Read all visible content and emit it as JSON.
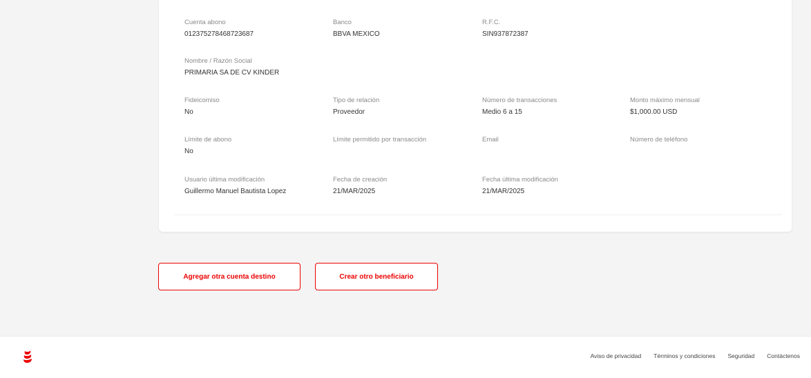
{
  "details": {
    "cuenta_abono": {
      "label": "Cuenta abono",
      "value": "012375278468723687"
    },
    "banco": {
      "label": "Banco",
      "value": "BBVA MEXICO"
    },
    "rfc": {
      "label": "R.F.C.",
      "value": "SIN937872387"
    },
    "nombre": {
      "label": "Nombre / Razón Social",
      "value": "PRIMARIA SA DE CV KINDER"
    },
    "fideicomiso": {
      "label": "Fideicomiso",
      "value": "No"
    },
    "tipo_relacion": {
      "label": "Tipo de relación",
      "value": "Proveedor"
    },
    "num_transacciones": {
      "label": "Número de transacciones",
      "value": "Medio 6 a 15"
    },
    "monto_maximo": {
      "label": "Monto máximo mensual",
      "value": "$1,000.00 USD"
    },
    "limite_abono": {
      "label": "Límite de abono",
      "value": "No"
    },
    "limite_transaccion": {
      "label": "Límite permitido por transacción",
      "value": ""
    },
    "email": {
      "label": "Email",
      "value": ""
    },
    "telefono": {
      "label": "Número de teléfono",
      "value": ""
    },
    "usuario_modificacion": {
      "label": "Usuario última modificación",
      "value": "Guillermo Manuel Bautista Lopez"
    },
    "fecha_creacion": {
      "label": "Fecha de creación",
      "value": "21/MAR/2025"
    },
    "fecha_modificacion": {
      "label": "Fecha última modificación",
      "value": "21/MAR/2025"
    }
  },
  "actions": {
    "add_account": "Agregar otra cuenta destino",
    "create_beneficiary": "Crear otro beneficiario"
  },
  "footer": {
    "links": [
      "Aviso de privacidad",
      "Términos y condiciones",
      "Seguridad",
      "Contáctenos"
    ]
  },
  "colors": {
    "brand": "#ec0000"
  }
}
